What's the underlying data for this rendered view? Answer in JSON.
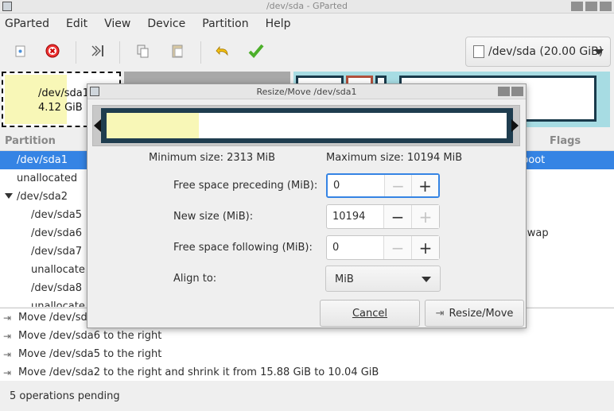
{
  "window": {
    "title": "/dev/sda - GParted"
  },
  "menu": [
    "GParted",
    "Edit",
    "View",
    "Device",
    "Partition",
    "Help"
  ],
  "device_selector": {
    "label": "/dev/sda (20.00 GiB)"
  },
  "diskmap": {
    "sda1_name": "/dev/sda1",
    "sda1_size": "4.12 GiB"
  },
  "columns": {
    "partition": "Partition",
    "flags": "Flags"
  },
  "partitions": [
    {
      "name": "/dev/sda1",
      "flag": "boot"
    },
    {
      "name": "unallocated",
      "flag": ""
    },
    {
      "name": "/dev/sda2",
      "flag": ""
    },
    {
      "name": "/dev/sda5",
      "flag": ""
    },
    {
      "name": "/dev/sda6",
      "flag": "swap"
    },
    {
      "name": "/dev/sda7",
      "flag": ""
    },
    {
      "name": "unallocate",
      "flag": ""
    },
    {
      "name": "/dev/sda8",
      "flag": ""
    },
    {
      "name": "unallocate",
      "flag": ""
    }
  ],
  "operations": [
    "Move /dev/sd",
    "Move /dev/sda6 to the right",
    "Move /dev/sda5 to the right",
    "Move /dev/sda2 to the right and shrink it from 15.88 GiB to 10.04 GiB"
  ],
  "status": "5 operations pending",
  "dialog": {
    "title": "Resize/Move /dev/sda1",
    "min_size": "Minimum size: 2313 MiB",
    "max_size": "Maximum size: 10194 MiB",
    "preceding_label": "Free space preceding (MiB):",
    "preceding_value": "0",
    "newsize_label": "New size (MiB):",
    "newsize_value": "10194",
    "following_label": "Free space following (MiB):",
    "following_value": "0",
    "align_label": "Align to:",
    "align_value": "MiB",
    "cancel": "Cancel",
    "resize": "Resize/Move",
    "used_fraction": 0.23
  }
}
